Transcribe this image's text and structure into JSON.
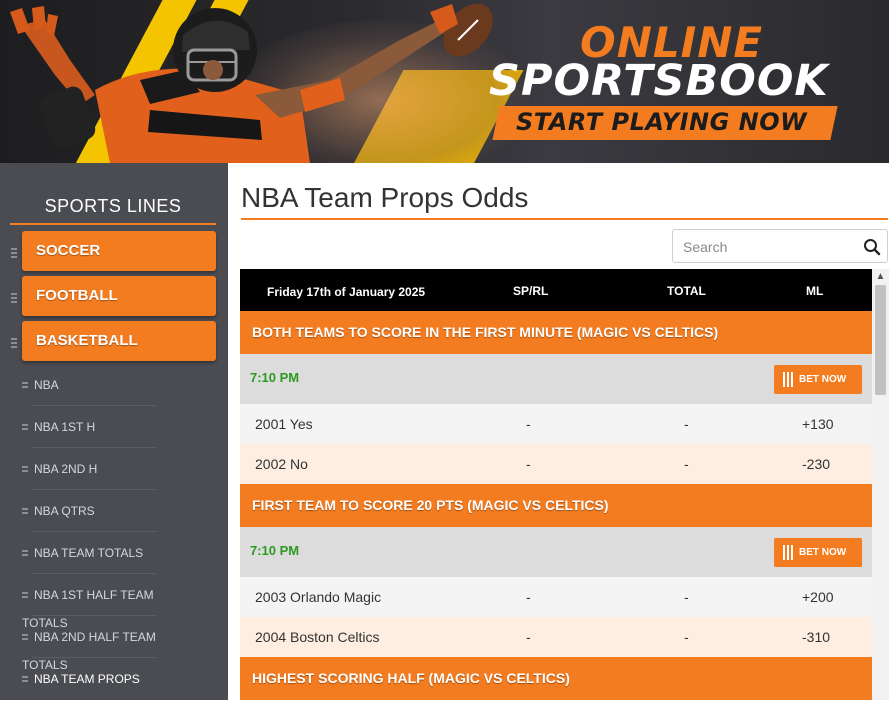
{
  "banner": {
    "headline_line1": "ONLINE",
    "headline_line2": "SPORTSBOOK",
    "cta": "START PLAYING NOW",
    "accent": "#f47c20"
  },
  "sidebar": {
    "title": "SPORTS LINES",
    "sports": [
      "SOCCER",
      "FOOTBALL",
      "BASKETBALL"
    ],
    "links": [
      "NBA",
      "NBA 1ST H",
      "NBA 2ND H",
      "NBA QTRS",
      "NBA TEAM TOTALS",
      "NBA 1ST HALF TEAM TOTALS",
      "NBA 2ND HALF TEAM TOTALS",
      "NBA TEAM PROPS"
    ],
    "active_link": "NBA TEAM PROPS"
  },
  "main": {
    "page_title": "NBA Team Props Odds",
    "search": {
      "placeholder": "Search"
    },
    "table": {
      "date": "Friday 17th of January 2025",
      "col_spread": "SP/RL",
      "col_total": "TOTAL",
      "col_ml": "ML",
      "bet_label": "BET NOW",
      "groups": [
        {
          "title": "BOTH TEAMS TO SCORE IN THE FIRST MINUTE (MAGIC VS CELTICS)",
          "time": "7:10 PM",
          "rows": [
            {
              "name": "2001 Yes",
              "spread": "-",
              "total": "-",
              "ml": "+130"
            },
            {
              "name": "2002 No",
              "spread": "-",
              "total": "-",
              "ml": "-230"
            }
          ]
        },
        {
          "title": "FIRST TEAM TO SCORE 20 PTS (MAGIC VS CELTICS)",
          "time": "7:10 PM",
          "rows": [
            {
              "name": "2003 Orlando Magic",
              "spread": "-",
              "total": "-",
              "ml": "+200"
            },
            {
              "name": "2004 Boston Celtics",
              "spread": "-",
              "total": "-",
              "ml": "-310"
            }
          ]
        },
        {
          "title": "HIGHEST SCORING HALF (MAGIC VS CELTICS)"
        }
      ]
    }
  }
}
